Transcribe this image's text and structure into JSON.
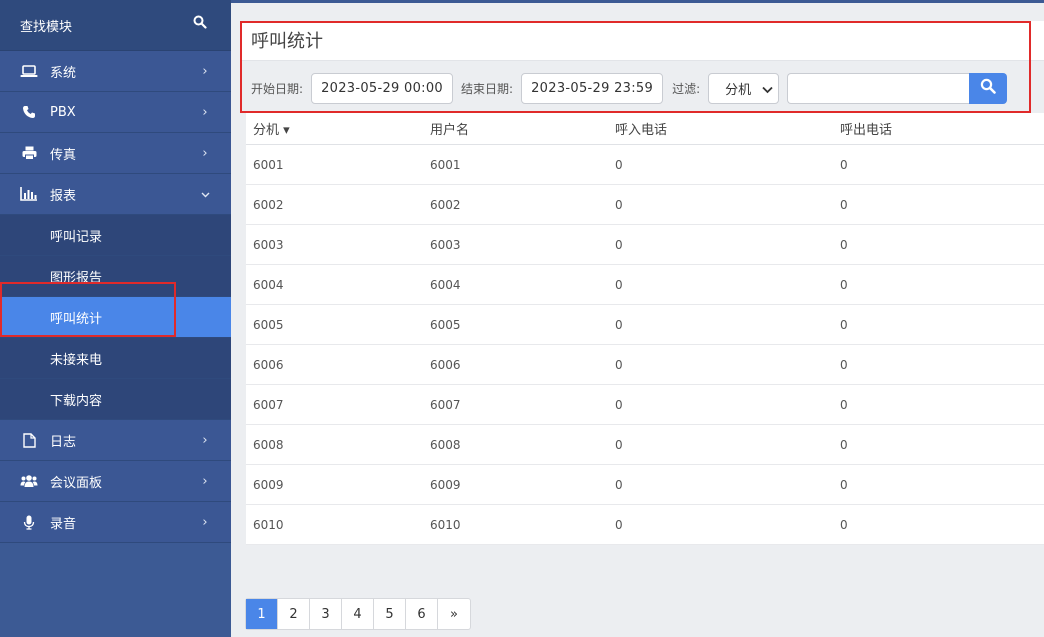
{
  "sidebar": {
    "search_title": "查找模块",
    "items": [
      {
        "label": "系统",
        "icon": "laptop-icon"
      },
      {
        "label": "PBX",
        "icon": "phone-icon"
      },
      {
        "label": "传真",
        "icon": "printer-icon"
      },
      {
        "label": "报表",
        "icon": "bar-chart-icon"
      }
    ],
    "report_sub": [
      "呼叫记录",
      "图形报告",
      "呼叫统计",
      "未接来电",
      "下载内容"
    ],
    "items_after": [
      {
        "label": "日志",
        "icon": "file-icon"
      },
      {
        "label": "会议面板",
        "icon": "users-icon"
      },
      {
        "label": "录音",
        "icon": "microphone-icon"
      }
    ]
  },
  "page": {
    "title": "呼叫统计"
  },
  "filters": {
    "start_label": "开始日期:",
    "start_value": "2023-05-29 00:00",
    "end_label": "结束日期:",
    "end_value": "2023-05-29 23:59",
    "filter_label": "过滤:",
    "filter_selected": "分机",
    "search_value": ""
  },
  "table": {
    "headers": [
      "分机 ▾",
      "用户名",
      "呼入电话",
      "呼出电话"
    ],
    "rows": [
      [
        "6001",
        "6001",
        "0",
        "0"
      ],
      [
        "6002",
        "6002",
        "0",
        "0"
      ],
      [
        "6003",
        "6003",
        "0",
        "0"
      ],
      [
        "6004",
        "6004",
        "0",
        "0"
      ],
      [
        "6005",
        "6005",
        "0",
        "0"
      ],
      [
        "6006",
        "6006",
        "0",
        "0"
      ],
      [
        "6007",
        "6007",
        "0",
        "0"
      ],
      [
        "6008",
        "6008",
        "0",
        "0"
      ],
      [
        "6009",
        "6009",
        "0",
        "0"
      ],
      [
        "6010",
        "6010",
        "0",
        "0"
      ]
    ]
  },
  "pagination": [
    "1",
    "2",
    "3",
    "4",
    "5",
    "6",
    "»"
  ],
  "colors": {
    "sidebar": "#3c5a94",
    "accent": "#4a86e8",
    "highlight_box": "#e02a2a"
  }
}
